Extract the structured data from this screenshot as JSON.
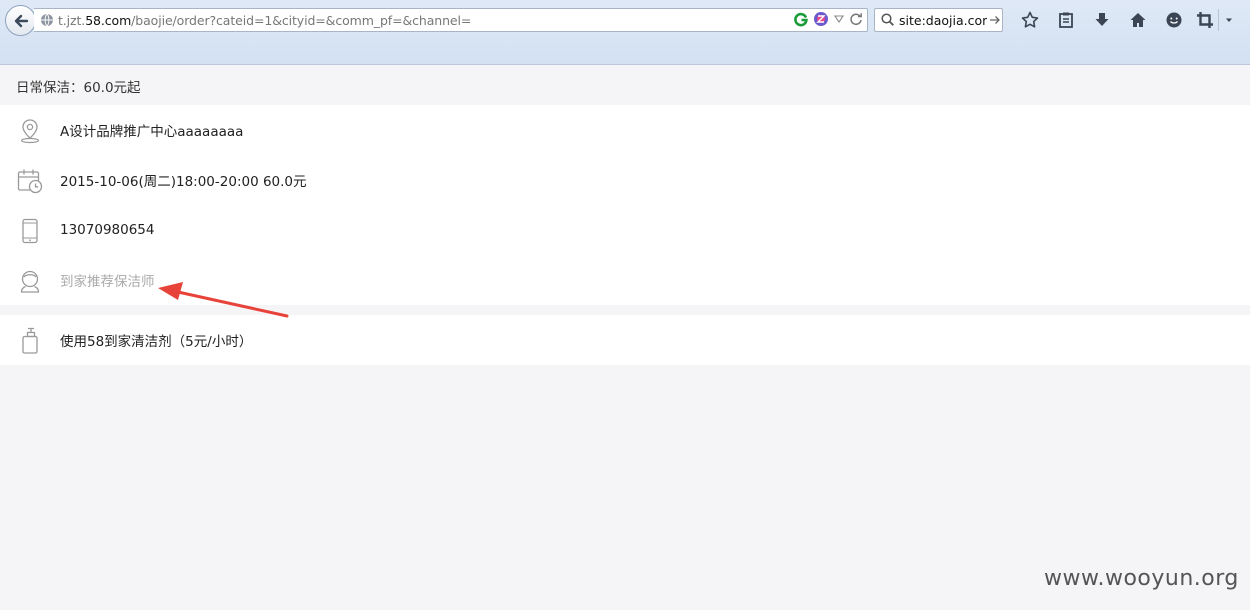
{
  "browser": {
    "url_host": "t.jzt.58.com",
    "url_prefix": "t.jzt.",
    "url_domain": "58.com",
    "url_path": "/baojie/order?cateid=1&cityid=&comm_pf=&channel=",
    "search_text": "site:daojia.com"
  },
  "page": {
    "service_summary": "日常保洁：60.0元起",
    "order_rows": [
      {
        "icon": "location-pin-icon",
        "text": "A设计品牌推广中心aaaaaaaa"
      },
      {
        "icon": "calendar-clock-icon",
        "text": "2015-10-06(周二)18:00-20:00 60.0元"
      },
      {
        "icon": "phone-icon",
        "text": "13070980654"
      },
      {
        "icon": "cleaner-avatar-icon",
        "text": "到家推荐保洁师"
      }
    ],
    "extra_row": {
      "icon": "detergent-bottle-icon",
      "text": "使用58到家清洁剂（5元/小时）"
    }
  },
  "watermark": "www.wooyun.org",
  "colors": {
    "arrow": "#e8433a",
    "icon_gray": "#999999",
    "muted_text": "#aaaaaa"
  }
}
